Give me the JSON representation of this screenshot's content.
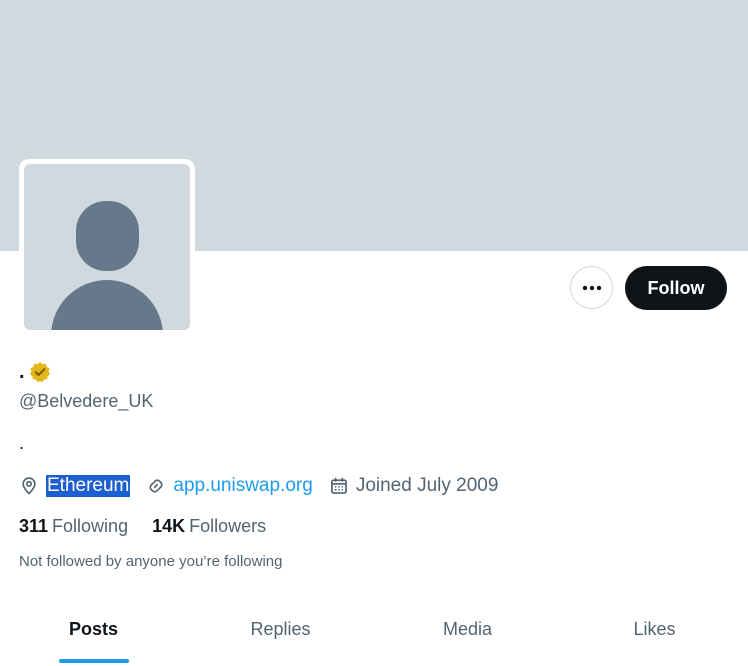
{
  "profile": {
    "display_name": ".",
    "handle": "@Belvedere_UK",
    "bio": ".",
    "location": "Ethereum",
    "website": "app.uniswap.org",
    "joined": "Joined July 2009",
    "following_count": "311",
    "following_label": "Following",
    "followers_count": "14K",
    "followers_label": "Followers",
    "not_followed_text": "Not followed by anyone you’re following"
  },
  "actions": {
    "follow_label": "Follow"
  },
  "tabs": [
    {
      "label": "Posts",
      "active": true
    },
    {
      "label": "Replies",
      "active": false
    },
    {
      "label": "Media",
      "active": false
    },
    {
      "label": "Likes",
      "active": false
    }
  ],
  "icons": {
    "verified": "verified-badge-icon",
    "location": "location-pin-icon",
    "link": "link-icon",
    "calendar": "calendar-icon",
    "more": "more-horizontal-icon"
  },
  "colors": {
    "banner": "#cfd9de",
    "follow_button": "#0f1419",
    "link": "#1d9bf0",
    "verified_gold": "#e2b719",
    "tab_underline": "#1d9bf0",
    "secondary_text": "#536471"
  }
}
